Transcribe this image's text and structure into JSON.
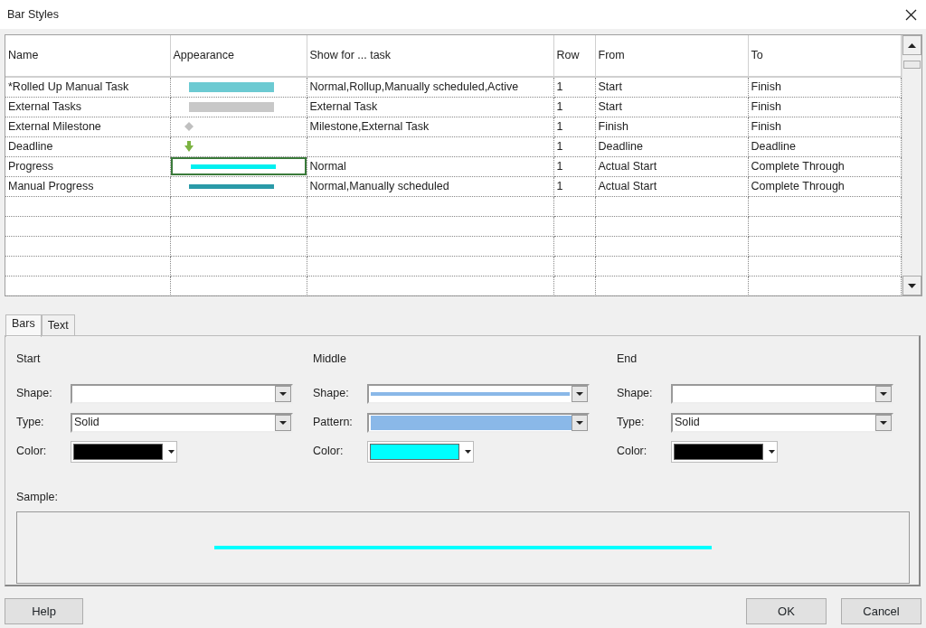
{
  "window": {
    "title": "Bar Styles"
  },
  "table": {
    "columns": [
      "Name",
      "Appearance",
      "Show for ... task",
      "Row",
      "From",
      "To"
    ],
    "rows": [
      {
        "name": "*Rolled Up Manual Task",
        "appearance": {
          "kind": "bar",
          "color": "#6ccad2"
        },
        "show_for": "Normal,Rollup,Manually scheduled,Active",
        "row": "1",
        "from": "Start",
        "to": "Finish",
        "selected": false
      },
      {
        "name": "External Tasks",
        "appearance": {
          "kind": "bar",
          "color": "#c8c8c8"
        },
        "show_for": "External Task",
        "row": "1",
        "from": "Start",
        "to": "Finish",
        "selected": false
      },
      {
        "name": "External Milestone",
        "appearance": {
          "kind": "diamond",
          "color": "#c0c0c0"
        },
        "show_for": "Milestone,External Task",
        "row": "1",
        "from": "Finish",
        "to": "Finish",
        "selected": false
      },
      {
        "name": "Deadline",
        "appearance": {
          "kind": "arrow",
          "color": "#7cb342"
        },
        "row": "1",
        "from": "Deadline",
        "to": "Deadline",
        "selected": false
      },
      {
        "name": "Progress",
        "appearance": {
          "kind": "line",
          "color": "#00f0f0"
        },
        "show_for": "Normal",
        "row": "1",
        "from": "Actual Start",
        "to": "Complete Through",
        "selected": true
      },
      {
        "name": "Manual Progress",
        "appearance": {
          "kind": "line",
          "color": "#2a9aa8"
        },
        "show_for": "Normal,Manually scheduled",
        "row": "1",
        "from": "Actual Start",
        "to": "Complete Through",
        "selected": false
      }
    ]
  },
  "tabs": [
    {
      "label": "Bars",
      "selected": true
    },
    {
      "label": "Text",
      "selected": false
    }
  ],
  "sections": [
    {
      "title": "Start",
      "fields": [
        {
          "label": "Shape:",
          "kind": "select"
        },
        {
          "label": "Type:",
          "kind": "select",
          "value": "Solid"
        },
        {
          "label": "Color:",
          "kind": "color",
          "color": "#000000"
        }
      ]
    },
    {
      "title": "Middle",
      "fields": [
        {
          "label": "Shape:",
          "kind": "shape",
          "color": "#8ab8e8"
        },
        {
          "label": "Pattern:",
          "kind": "pattern",
          "color": "#8ab8e8"
        },
        {
          "label": "Color:",
          "kind": "color",
          "color": "#00ffff"
        }
      ]
    },
    {
      "title": "End",
      "fields": [
        {
          "label": "Shape:",
          "kind": "select"
        },
        {
          "label": "Type:",
          "kind": "select",
          "value": "Solid"
        },
        {
          "label": "Color:",
          "kind": "color",
          "color": "#000000"
        }
      ]
    }
  ],
  "sample": {
    "label": "Sample:",
    "color": "#00ffff"
  },
  "buttons": {
    "left": [
      "Help"
    ],
    "right": [
      "OK",
      "Cancel"
    ]
  }
}
